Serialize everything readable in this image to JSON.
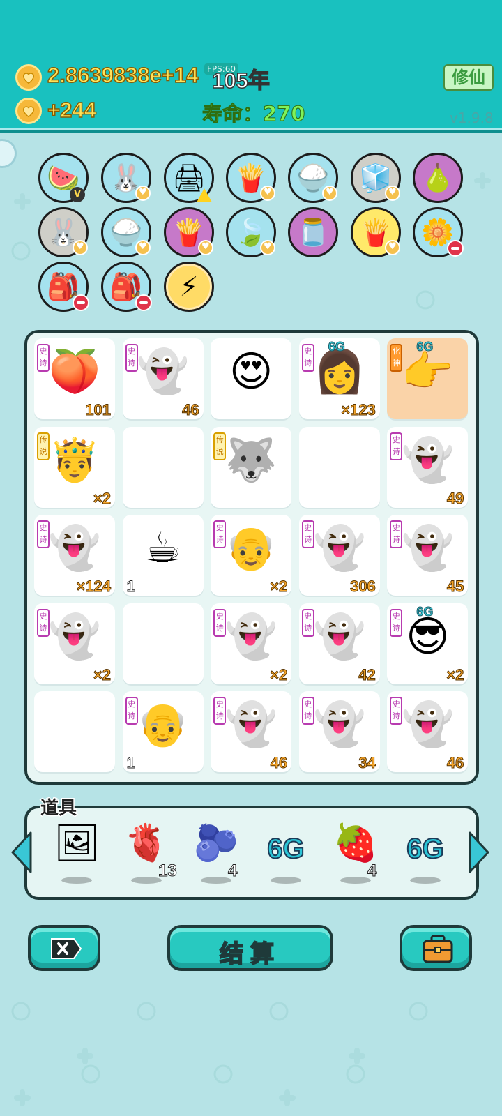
{
  "header": {
    "coins": "2.8639838e+14",
    "fps_tag": "FPS:60",
    "year": "105年",
    "income": "+244",
    "lifespan": "寿命：270",
    "cultivate_label": "修仙",
    "version": "v1.9.8"
  },
  "shelf_items": [
    {
      "name": "fruit-basket",
      "icon": "🍉",
      "bg": "sky",
      "badge": "v"
    },
    {
      "name": "rabbit",
      "icon": "🐰",
      "bg": "sky",
      "badge": "heart"
    },
    {
      "name": "printer",
      "icon": "🖨",
      "bg": "sky",
      "badge": "warn"
    },
    {
      "name": "fries",
      "icon": "🍟",
      "bg": "sky",
      "badge": "heart"
    },
    {
      "name": "rice-bowl",
      "icon": "🍚",
      "bg": "sky",
      "badge": "heart"
    },
    {
      "name": "sugar-cubes",
      "icon": "🧊",
      "bg": "grey",
      "badge": "heart"
    },
    {
      "name": "pomelo",
      "icon": "🍐",
      "bg": "purple",
      "badge": ""
    },
    {
      "name": "rabbit",
      "icon": "🐰",
      "bg": "grey",
      "badge": "heart"
    },
    {
      "name": "rice-bowl",
      "icon": "🍚",
      "bg": "sky",
      "badge": "heart"
    },
    {
      "name": "fries",
      "icon": "🍟",
      "bg": "purple",
      "badge": "heart"
    },
    {
      "name": "leaf",
      "icon": "🍃",
      "bg": "sky",
      "badge": "heart"
    },
    {
      "name": "jar",
      "icon": "🫙",
      "bg": "purple",
      "badge": ""
    },
    {
      "name": "fries",
      "icon": "🍟",
      "bg": "yellow",
      "badge": "heart"
    },
    {
      "name": "flower-pot",
      "icon": "🌼",
      "bg": "sky",
      "badge": "minus"
    },
    {
      "name": "sack",
      "icon": "🎒",
      "bg": "sky",
      "badge": "minus"
    },
    {
      "name": "sack",
      "icon": "🎒",
      "bg": "sky",
      "badge": "minus"
    },
    {
      "name": "lightning-coin",
      "icon": "⚡",
      "bg": "bigcoin",
      "badge": ""
    }
  ],
  "grid": [
    {
      "icon": "🍑",
      "tag": "史诗",
      "tag_style": "",
      "count": "101",
      "top_label": "",
      "bg": ""
    },
    {
      "icon": "👻",
      "tag": "史诗",
      "tag_style": "",
      "count": "46",
      "top_label": "",
      "bg": ""
    },
    {
      "icon": "😍",
      "tag": "",
      "tag_style": "",
      "count": "",
      "top_label": "",
      "bg": ""
    },
    {
      "icon": "👩",
      "tag": "史诗",
      "tag_style": "",
      "count": "×123",
      "top_label": "6G",
      "bg": ""
    },
    {
      "icon": "👉",
      "tag": "化神",
      "tag_style": "orange",
      "count": "",
      "top_label": "6G",
      "bg": "peach"
    },
    {
      "icon": "🤴",
      "tag": "传说",
      "tag_style": "gold",
      "count": "×2",
      "top_label": "",
      "bg": ""
    },
    {
      "icon": "",
      "tag": "",
      "tag_style": "",
      "count": "",
      "top_label": "",
      "bg": ""
    },
    {
      "icon": "🐺",
      "tag": "传说",
      "tag_style": "gold",
      "count": "",
      "top_label": "",
      "bg": ""
    },
    {
      "icon": "",
      "tag": "",
      "tag_style": "",
      "count": "",
      "top_label": "",
      "bg": ""
    },
    {
      "icon": "👻",
      "tag": "史诗",
      "tag_style": "",
      "count": "49",
      "top_label": "",
      "bg": ""
    },
    {
      "icon": "👻",
      "tag": "史诗",
      "tag_style": "",
      "count": "×124",
      "top_label": "",
      "bg": ""
    },
    {
      "icon": "☕",
      "tag": "",
      "tag_style": "",
      "count": "1",
      "count_style": "white",
      "top_label": "",
      "bg": ""
    },
    {
      "icon": "👴",
      "tag": "史诗",
      "tag_style": "",
      "count": "×2",
      "top_label": "",
      "bg": ""
    },
    {
      "icon": "👻",
      "tag": "史诗",
      "tag_style": "",
      "count": "306",
      "top_label": "",
      "bg": ""
    },
    {
      "icon": "👻",
      "tag": "史诗",
      "tag_style": "",
      "count": "45",
      "top_label": "",
      "bg": ""
    },
    {
      "icon": "👻",
      "tag": "史诗",
      "tag_style": "",
      "count": "×2",
      "top_label": "",
      "bg": ""
    },
    {
      "icon": "",
      "tag": "",
      "tag_style": "",
      "count": "",
      "top_label": "",
      "bg": ""
    },
    {
      "icon": "👻",
      "tag": "史诗",
      "tag_style": "",
      "count": "×2",
      "top_label": "",
      "bg": ""
    },
    {
      "icon": "👻",
      "tag": "史诗",
      "tag_style": "",
      "count": "42",
      "top_label": "",
      "bg": ""
    },
    {
      "icon": "😎",
      "tag": "史诗",
      "tag_style": "",
      "count": "×2",
      "top_label": "6G",
      "bg": ""
    },
    {
      "icon": "",
      "tag": "",
      "tag_style": "",
      "count": "",
      "top_label": "",
      "bg": ""
    },
    {
      "icon": "👴",
      "tag": "史诗",
      "tag_style": "",
      "count": "1",
      "count_style": "white",
      "top_label": "",
      "bg": ""
    },
    {
      "icon": "👻",
      "tag": "史诗",
      "tag_style": "",
      "count": "46",
      "top_label": "",
      "bg": ""
    },
    {
      "icon": "👻",
      "tag": "史诗",
      "tag_style": "",
      "count": "34",
      "top_label": "",
      "bg": ""
    },
    {
      "icon": "👻",
      "tag": "史诗",
      "tag_style": "",
      "count": "46",
      "top_label": "",
      "bg": ""
    }
  ],
  "tools": {
    "title": "道具",
    "items": [
      {
        "name": "picture-frame",
        "icon": "🖼",
        "count": ""
      },
      {
        "name": "liver",
        "icon": "🫀",
        "count": "13"
      },
      {
        "name": "blueberry",
        "icon": "🫐",
        "count": "4"
      },
      {
        "name": "6g",
        "label": "6G",
        "count": ""
      },
      {
        "name": "strawberry",
        "icon": "🍓",
        "count": "4"
      },
      {
        "name": "6g",
        "label": "6G",
        "count": ""
      }
    ]
  },
  "buttons": {
    "settle_label": "结算"
  },
  "colors": {
    "header_bg": "#19c1bf",
    "background": "#b6e3e6",
    "button_bg": "#28c9c0",
    "coin_text": "#ffe35a",
    "lifespan_text": "#7ff25a"
  }
}
